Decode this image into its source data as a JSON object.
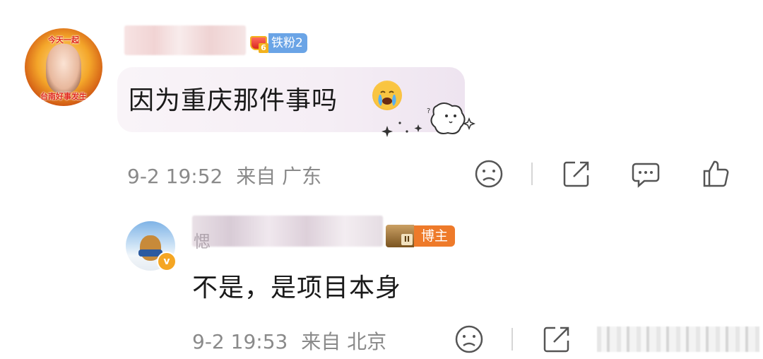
{
  "comment_1": {
    "avatar_top_text": "今天一起",
    "avatar_bottom_text": "台南好事发生",
    "fan_badge_level": "6",
    "fan_badge_label": "铁粉2",
    "text": "因为重庆那件事吗",
    "emoji": "crying-face",
    "time": "9-2 19:52",
    "location": "来自 广东"
  },
  "reply_1": {
    "name_partial": "愢",
    "blogger_badge_level": "II",
    "blogger_badge_label": "博主",
    "text": "不是，是项目本身",
    "time": "9-2 19:53",
    "location": "来自 北京"
  },
  "icons": {
    "dislike": "sad-face-icon",
    "share": "share-icon",
    "comment": "comment-icon",
    "like": "thumbs-up-icon"
  },
  "colors": {
    "fan_badge": "#6aa4e6",
    "blogger_badge": "#ee7a2a",
    "meta_text": "#8a8a8a"
  }
}
